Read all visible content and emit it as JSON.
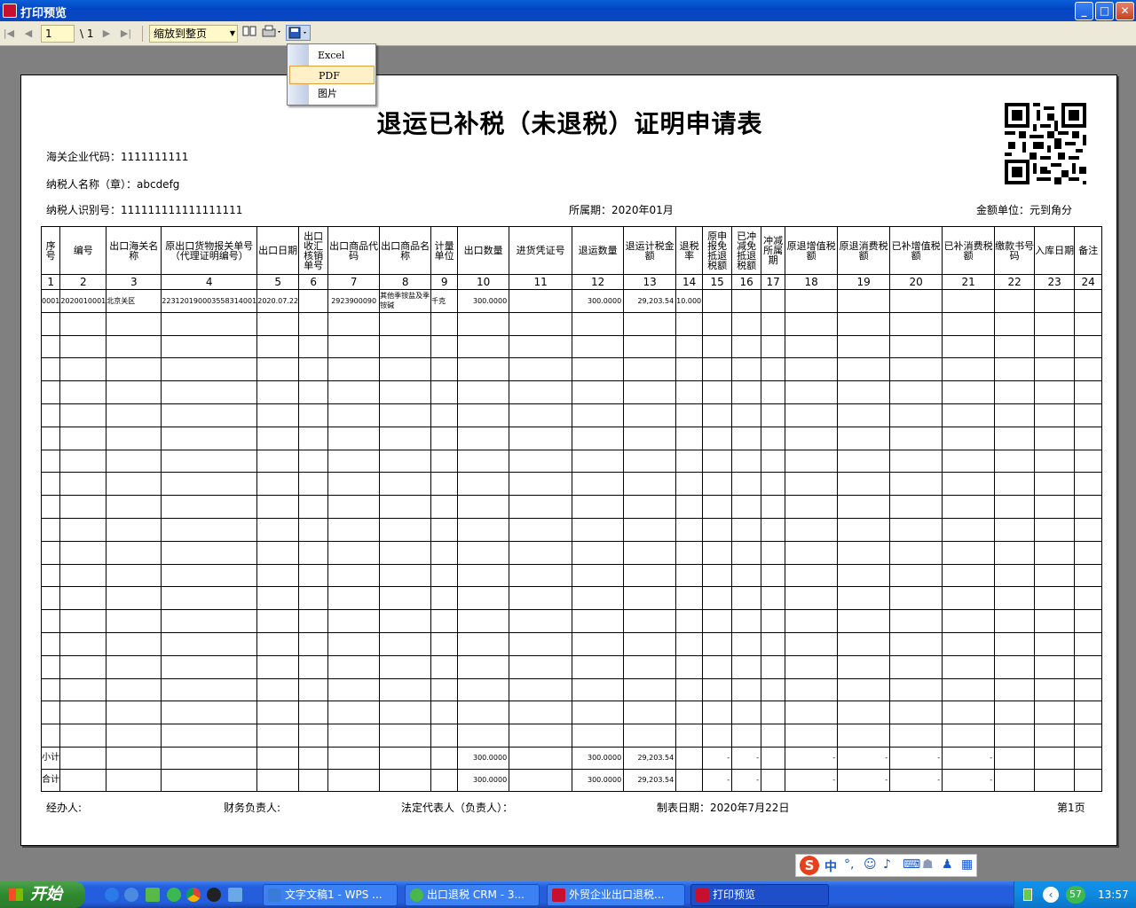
{
  "window": {
    "title": "打印预览",
    "min": "_",
    "max": "□",
    "close": "✕"
  },
  "toolbar": {
    "page_current": "1",
    "page_total": "\\ 1",
    "zoom": "缩放到整页",
    "icons": [
      "first-page-icon",
      "prev-page-icon",
      "next-page-icon",
      "last-page-icon",
      "book-icon",
      "printer-icon",
      "save-icon"
    ]
  },
  "export_menu": {
    "items": [
      "Excel",
      "PDF",
      "图片"
    ],
    "highlighted": "PDF"
  },
  "doc": {
    "title": "退运已补税（未退税）证明申请表",
    "customs_code": "海关企业代码：1111111111",
    "taxpayer_name": "纳税人名称（章）：abcdefg",
    "taxpayer_id": "纳税人识别号：111111111111111111",
    "period": "所属期：2020年01月",
    "unit": "金额单位：元到角分",
    "headers": [
      "序号",
      "编号",
      "出口海关名称",
      "原出口货物报关单号（代理证明编号）",
      "出口日期",
      "出口收汇核销单号",
      "出口商品代码",
      "出口商品名称",
      "计量单位",
      "出口数量",
      "进货凭证号",
      "退运数量",
      "退运计税金额",
      "退税率",
      "原申报免抵退税额",
      "已冲减免抵退税额",
      "冲减所属期",
      "原退增值税额",
      "原退消费税额",
      "已补增值税额",
      "已补消费税额",
      "缴款书号码",
      "入库日期",
      "备注"
    ],
    "col_numbers": [
      "1",
      "2",
      "3",
      "4",
      "5",
      "6",
      "7",
      "8",
      "9",
      "10",
      "11",
      "12",
      "13",
      "14",
      "15",
      "16",
      "17",
      "18",
      "19",
      "20",
      "21",
      "22",
      "23",
      "24"
    ],
    "row1": [
      "0001",
      "2020010001",
      "北京关区",
      "223120190003558314001",
      "2020.07.22",
      "",
      "2923900090",
      "其他季铵盐及季铵碱",
      "千克",
      "300.0000",
      "",
      "300.0000",
      "29,203.54",
      "10.000",
      "",
      "",
      "",
      "",
      "",
      "",
      "",
      "",
      "",
      ""
    ],
    "subtotal_label": "小计",
    "total_label": "合计",
    "subtotal": {
      "qty": "300.0000",
      "ret_qty": "300.0000",
      "amount": "29,203.54",
      "dash": "-"
    },
    "total": {
      "qty": "300.0000",
      "ret_qty": "300.0000",
      "amount": "29,203.54",
      "dash": "-"
    },
    "footer": {
      "handler": "经办人:",
      "finance": "财务负责人:",
      "legal": "法定代表人（负责人）：",
      "date": "制表日期：2020年7月22日",
      "page": "第1页"
    }
  },
  "ime": {
    "label": "中"
  },
  "taskbar": {
    "start": "开始",
    "tasks": [
      "文字文稿1 - WPS ...",
      "出口退税 CRM - 3...",
      "外贸企业出口退税...",
      "打印预览"
    ],
    "badge": "57",
    "clock": "13:57"
  }
}
